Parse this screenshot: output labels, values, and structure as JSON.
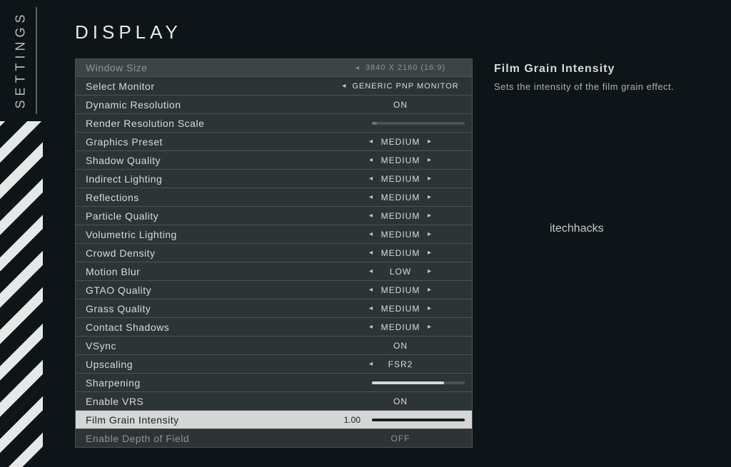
{
  "sidebar": {
    "label": "SETTINGS"
  },
  "page": {
    "title": "DISPLAY"
  },
  "description": {
    "title": "Film Grain Intensity",
    "body": "Sets the intensity of the film grain effect."
  },
  "watermark": "itechhacks",
  "rows": {
    "window_size": {
      "label": "Window Size",
      "value": "3840 X 2160 (16:9)"
    },
    "select_monitor": {
      "label": "Select Monitor",
      "value": "GENERIC PNP MONITOR"
    },
    "dyn_res": {
      "label": "Dynamic Resolution",
      "value": "ON"
    },
    "render_scale": {
      "label": "Render Resolution Scale"
    },
    "gpreset": {
      "label": "Graphics Preset",
      "value": "MEDIUM"
    },
    "shadow": {
      "label": "Shadow Quality",
      "value": "MEDIUM"
    },
    "indirect": {
      "label": "Indirect Lighting",
      "value": "MEDIUM"
    },
    "reflections": {
      "label": "Reflections",
      "value": "MEDIUM"
    },
    "particle": {
      "label": "Particle Quality",
      "value": "MEDIUM"
    },
    "volumetric": {
      "label": "Volumetric Lighting",
      "value": "MEDIUM"
    },
    "crowd": {
      "label": "Crowd Density",
      "value": "MEDIUM"
    },
    "motion_blur": {
      "label": "Motion Blur",
      "value": "LOW"
    },
    "gtao": {
      "label": "GTAO Quality",
      "value": "MEDIUM"
    },
    "grass": {
      "label": "Grass Quality",
      "value": "MEDIUM"
    },
    "contact": {
      "label": "Contact Shadows",
      "value": "MEDIUM"
    },
    "vsync": {
      "label": "VSync",
      "value": "ON"
    },
    "upscaling": {
      "label": "Upscaling",
      "value": "FSR2"
    },
    "sharpening": {
      "label": "Sharpening"
    },
    "vrs": {
      "label": "Enable VRS",
      "value": "ON"
    },
    "film_grain": {
      "label": "Film Grain Intensity",
      "value": "1.00"
    },
    "dof": {
      "label": "Enable Depth of Field",
      "value": "OFF"
    }
  }
}
